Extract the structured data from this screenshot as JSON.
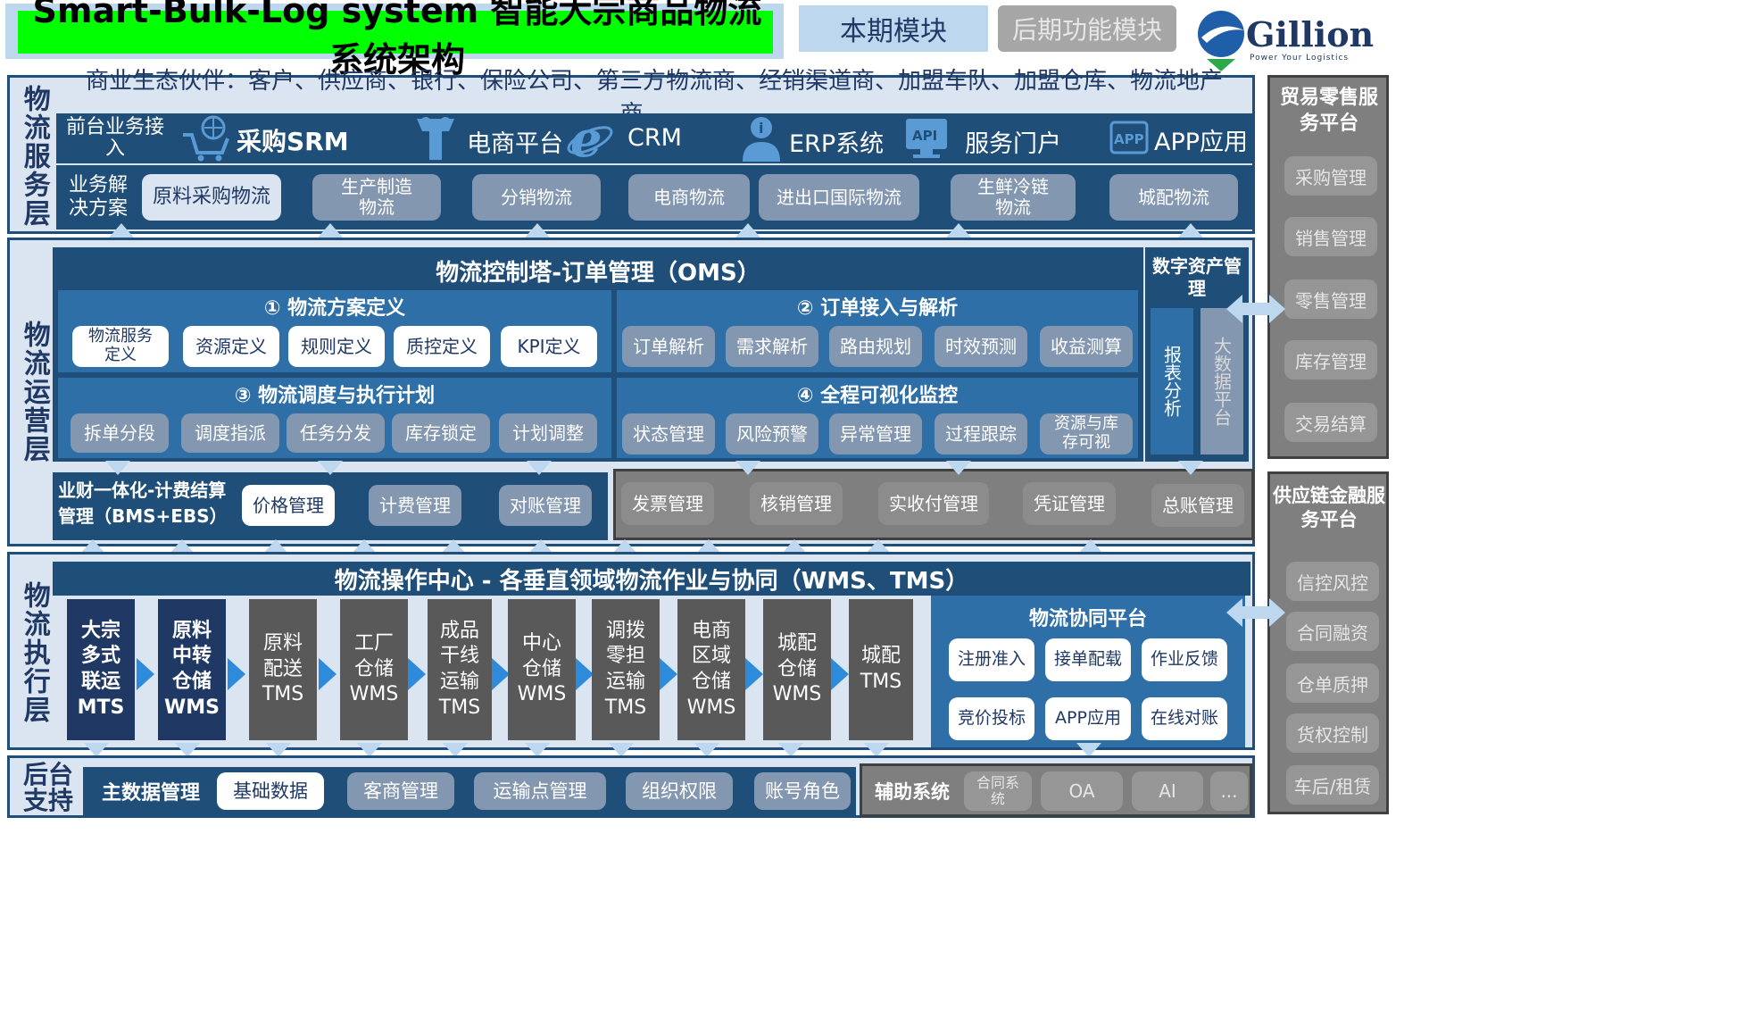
{
  "header": {
    "title": "Smart-Bulk-Log system 智能大宗商品物流系统架构",
    "legend_current": "本期模块",
    "legend_later": "后期功能模块",
    "logo_text": "Gillion",
    "logo_tagline": "Power Your Logistics"
  },
  "service_layer": {
    "label": "物流服务层",
    "partners": "商业生态伙伴：客户、供应商、银行、保险公司、第三方物流商、经销渠道商、加盟车队、加盟仓库、物流地产商、...",
    "front_label": "前台业务接入",
    "front_items": [
      {
        "label": "采购SRM",
        "icon": "shopping-cart-globe-icon"
      },
      {
        "label": "电商平台",
        "icon": "gift-shop-icon"
      },
      {
        "label": "CRM",
        "icon": "ie-browser-icon"
      },
      {
        "label": "ERP系统",
        "icon": "info-person-icon"
      },
      {
        "label": "服务门户",
        "icon": "api-monitor-icon"
      },
      {
        "label": "APP应用",
        "icon": "app-icon"
      }
    ],
    "solution_label": "业务解决方案",
    "solutions": [
      "原料采购物流",
      "生产制造物流",
      "分销物流",
      "电商物流",
      "进出口国际物流",
      "生鲜冷链物流",
      "城配物流"
    ]
  },
  "ops_layer": {
    "label": "物流运营层",
    "oms_title": "物流控制塔-订单管理（OMS）",
    "sec1": {
      "title": "① 物流方案定义",
      "items": [
        "物流服务定义",
        "资源定义",
        "规则定义",
        "质控定义",
        "KPI定义"
      ]
    },
    "sec2": {
      "title": "② 订单接入与解析",
      "items": [
        "订单解析",
        "需求解析",
        "路由规划",
        "时效预测",
        "收益测算"
      ]
    },
    "sec3": {
      "title": "③ 物流调度与执行计划",
      "items": [
        "拆单分段",
        "调度指派",
        "任务分发",
        "库存锁定",
        "计划调整"
      ]
    },
    "sec4": {
      "title": "④ 全程可视化监控",
      "items": [
        "状态管理",
        "风险预警",
        "异常管理",
        "过程跟踪",
        "资源与库存可视"
      ]
    },
    "digital_title": "数字资产管理",
    "digital_left": "报表分析",
    "digital_right": "大数据平台",
    "bms_title": "业财一体化-计费结算管理（BMS+EBS）",
    "bms_items": [
      "价格管理",
      "计费管理",
      "对账管理"
    ],
    "ebs_items": [
      "发票管理",
      "核销管理",
      "实收付管理",
      "凭证管理",
      "总账管理"
    ]
  },
  "exec_layer": {
    "label": "物流执行层",
    "title": "物流操作中心 - 各垂直领域物流作业与协同（WMS、TMS）",
    "boxes": [
      "大宗多式联运MTS",
      "原料中转仓储WMS",
      "原料配送TMS",
      "工厂仓储WMS",
      "成品干线运输TMS",
      "中心仓储WMS",
      "调拨零担运输TMS",
      "电商区域仓储WMS",
      "城配仓储WMS",
      "城配TMS"
    ],
    "collab_title": "物流协同平台",
    "collab_items": [
      "注册准入",
      "接单配载",
      "作业反馈",
      "竞价投标",
      "APP应用",
      "在线对账"
    ]
  },
  "back_layer": {
    "label": "后台支持",
    "master_title": "主数据管理",
    "master_items": [
      "基础数据",
      "客商管理",
      "运输点管理",
      "组织权限",
      "账号角色"
    ],
    "aux_title": "辅助系统",
    "aux_items": [
      "合同系统",
      "OA",
      "AI",
      "..."
    ]
  },
  "right_panels": {
    "trade": {
      "title": "贸易零售服务平台",
      "items": [
        "采购管理",
        "销售管理",
        "零售管理",
        "库存管理",
        "交易结算"
      ]
    },
    "finance": {
      "title": "供应链金融服务平台",
      "items": [
        "信控风控",
        "合同融资",
        "仓单质押",
        "货权控制",
        "车后/租赁"
      ]
    }
  }
}
